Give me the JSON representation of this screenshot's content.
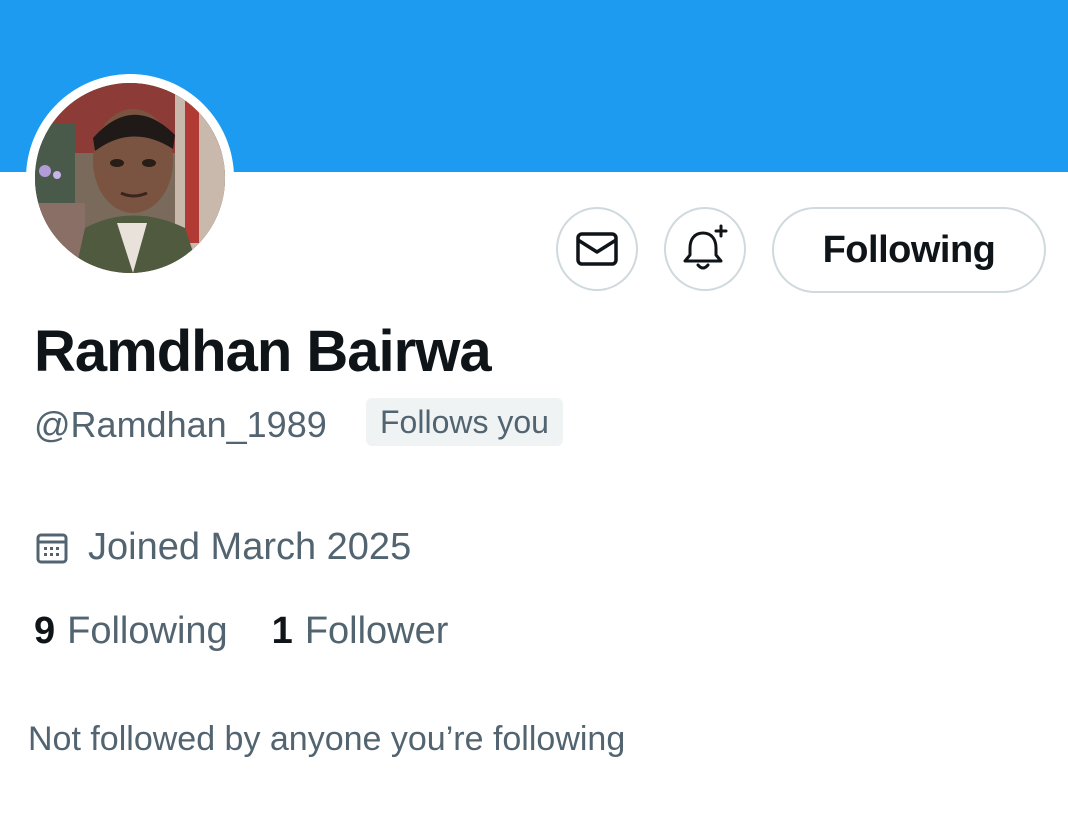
{
  "profile": {
    "display_name": "Ramdhan Bairwa",
    "handle": "@Ramdhan_1989",
    "follows_you_badge": "Follows you",
    "joined": "Joined March 2025",
    "following_count": "9",
    "following_label": "Following",
    "follower_count": "1",
    "follower_label": "Follower",
    "mutuals_text": "Not followed by anyone you’re following"
  },
  "actions": {
    "message_icon": "envelope-icon",
    "notify_icon": "bell-plus-icon",
    "following_button_label": "Following"
  },
  "colors": {
    "banner": "#1d9bf0",
    "primary_text": "#0f1419",
    "secondary_text": "#536471",
    "border": "#cfd9de",
    "badge_bg": "#eff3f4"
  }
}
